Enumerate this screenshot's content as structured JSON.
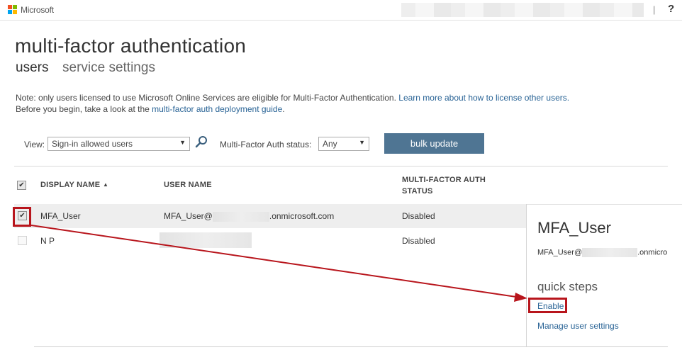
{
  "header": {
    "brand": "Microsoft",
    "separator": "|",
    "help": "?",
    "brand_colors": [
      "#f25022",
      "#7fba00",
      "#00a4ef",
      "#ffb900"
    ]
  },
  "page": {
    "title": "multi-factor authentication",
    "tabs": [
      {
        "label": "users",
        "active": true
      },
      {
        "label": "service settings",
        "active": false
      }
    ]
  },
  "note": {
    "line1_text": "Note: only users licensed to use Microsoft Online Services are eligible for Multi-Factor Authentication.",
    "line1_link": "Learn more about how to license other users.",
    "line2_text": "Before you begin, take a look at the",
    "line2_link": "multi-factor auth deployment guide",
    "line2_end": "."
  },
  "filters": {
    "view_label": "View:",
    "view_value": "Sign-in allowed users",
    "status_label": "Multi-Factor Auth status:",
    "status_value": "Any",
    "caret": "▼",
    "bulk_update": "bulk update"
  },
  "table": {
    "columns": {
      "display_name": "DISPLAY NAME",
      "sort_indicator": "▲",
      "user_name": "USER NAME",
      "mfa_status_line1": "MULTI-FACTOR AUTH",
      "mfa_status_line2": "STATUS"
    },
    "rows": [
      {
        "display_name": "MFA_User",
        "user_prefix": "MFA_User@",
        "user_suffix": ".onmicrosoft.com",
        "status": "Disabled",
        "checked": true
      },
      {
        "display_name": "N P",
        "user_prefix": "",
        "user_suffix": "",
        "status": "Disabled",
        "checked": false
      }
    ],
    "checkmark": "✔"
  },
  "detail_panel": {
    "name": "MFA_User",
    "email_prefix": "MFA_User@",
    "email_suffix": ".onmicro",
    "quick_steps_title": "quick steps",
    "enable_link": "Enable",
    "manage_link": "Manage user settings"
  },
  "annotation_color": "#b8151c"
}
